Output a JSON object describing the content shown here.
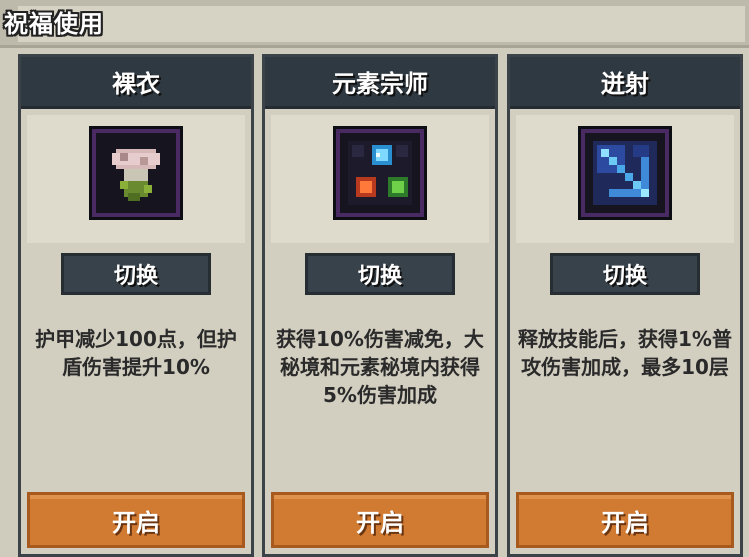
{
  "header": {
    "title": "祝福使用"
  },
  "blessings": [
    {
      "name": "裸衣",
      "icon": "armor-flower-icon",
      "switch_label": "切换",
      "description": "护甲减少100点，但护盾伤害提升10%",
      "open_label": "开启"
    },
    {
      "name": "元素宗师",
      "icon": "elemental-orbs-icon",
      "switch_label": "切换",
      "description": "获得10%伤害减免，大秘境和元素秘境内获得5%伤害加成",
      "open_label": "开启"
    },
    {
      "name": "迸射",
      "icon": "burst-arrows-icon",
      "switch_label": "切换",
      "description": "释放技能后，获得1%普攻伤害加成，最多10层",
      "open_label": "开启"
    }
  ]
}
